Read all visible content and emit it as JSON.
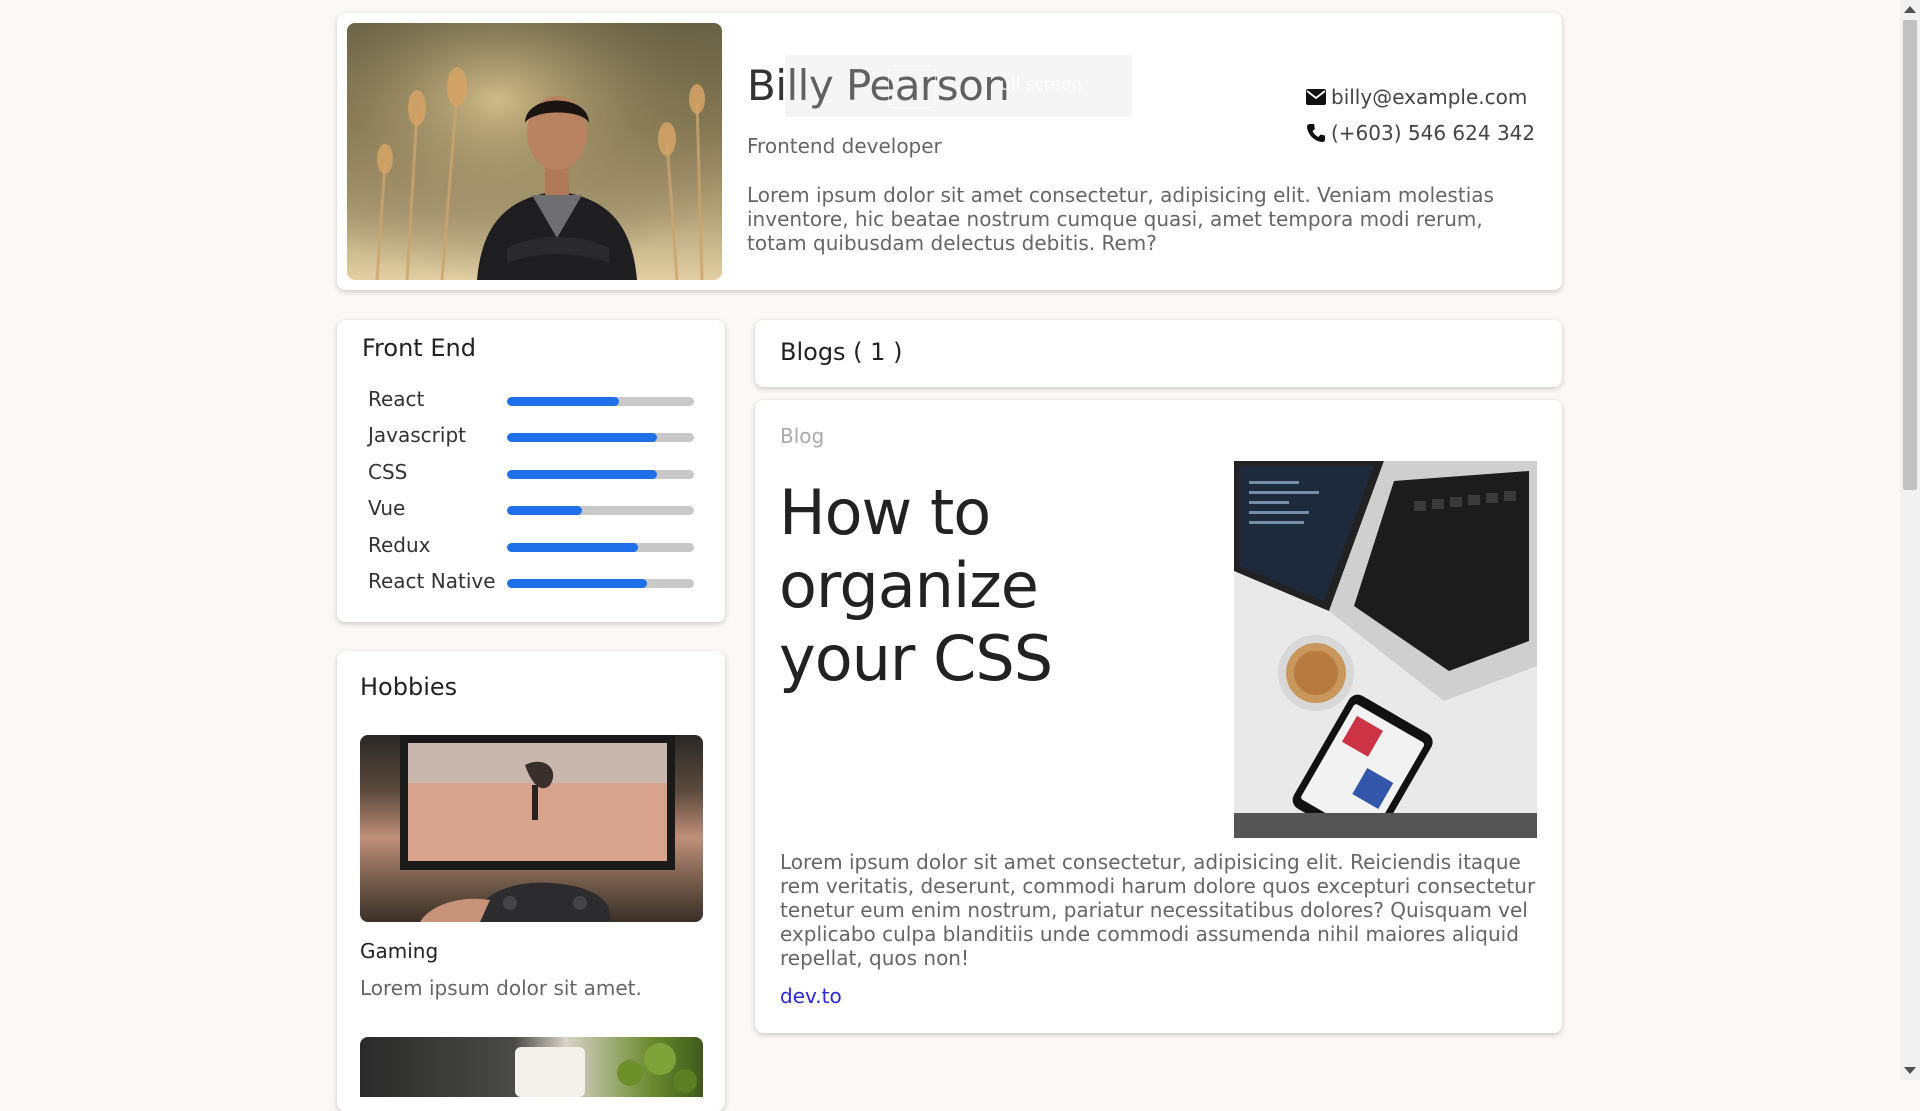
{
  "profile": {
    "name": "Billy Pearson",
    "role": "Frontend developer",
    "bio": "Lorem ipsum dolor sit amet consectetur, adipisicing elit. Veniam molestias inventore, hic beatae nostrum cumque quasi, amet tempora modi rerum, totam quibusdam delectus debitis. Rem?",
    "email": "billy@example.com",
    "phone": "(+603) 546 624 342",
    "email_icon": "envelope-icon",
    "phone_icon": "phone-icon"
  },
  "overlay": {
    "fullscreen_text": "ull screen"
  },
  "skills": {
    "title": "Front End",
    "items": [
      {
        "label": "React",
        "level": 0.6
      },
      {
        "label": "Javascript",
        "level": 0.8
      },
      {
        "label": "CSS",
        "level": 0.8
      },
      {
        "label": "Vue",
        "level": 0.4
      },
      {
        "label": "Redux",
        "level": 0.7
      },
      {
        "label": "React Native",
        "level": 0.75
      }
    ]
  },
  "hobbies": {
    "title": "Hobbies",
    "items": [
      {
        "name": "Gaming",
        "description": "Lorem ipsum dolor sit amet."
      }
    ]
  },
  "blogs": {
    "header": "Blogs ( 1 )",
    "post": {
      "tag": "Blog",
      "title": "How to organize your CSS",
      "excerpt": "Lorem ipsum dolor sit amet consectetur, adipisicing elit. Reiciendis itaque rem veritatis, deserunt, commodi harum dolore quos excepturi consectetur tenetur eum enim nostrum, pariatur necessitatibus dolores? Quisquam vel explicabo culpa blanditiis unde commodi assumenda nihil maiores aliquid repellat, quos non!",
      "link_text": "dev.to"
    }
  },
  "colors": {
    "background": "#fcf8f8",
    "accent": "#1e6fe8",
    "link": "#2a2ad6"
  }
}
